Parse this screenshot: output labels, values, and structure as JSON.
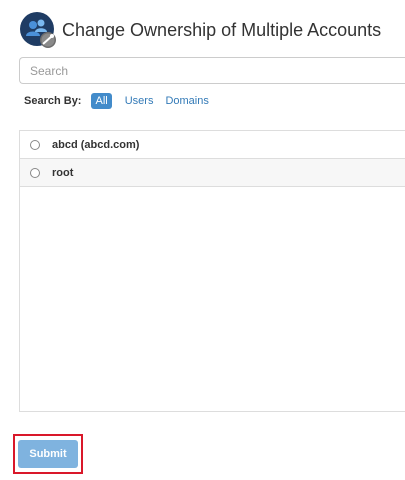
{
  "header": {
    "title": "Change Ownership of Multiple Accounts",
    "icon": "users-key-icon"
  },
  "search": {
    "placeholder": "Search",
    "value": ""
  },
  "search_by": {
    "label": "Search By:",
    "options": [
      {
        "label": "All",
        "active": true
      },
      {
        "label": "Users",
        "active": false
      },
      {
        "label": "Domains",
        "active": false
      }
    ]
  },
  "accounts": {
    "items": [
      {
        "label": "abcd (abcd.com)",
        "selected": false
      },
      {
        "label": "root",
        "selected": false
      }
    ]
  },
  "actions": {
    "submit_label": "Submit"
  },
  "colors": {
    "accent": "#428bca",
    "submit_disabled": "#7fb3df",
    "highlight": "#d9182a"
  }
}
